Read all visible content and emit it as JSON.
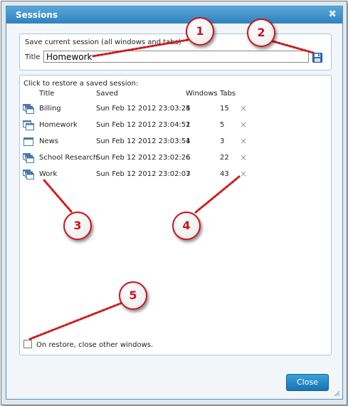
{
  "dialog": {
    "title": "Sessions"
  },
  "save_section": {
    "heading": "Save current session (all windows and tabs)",
    "title_label": "Title",
    "title_value": "Homework"
  },
  "restore_section": {
    "heading": "Click to restore a saved session:",
    "columns": {
      "title": "Title",
      "saved": "Saved",
      "windows": "Windows",
      "tabs": "Tabs"
    },
    "sessions": [
      {
        "title": "Billing",
        "saved": "Sun Feb 12 2012 23:03:25",
        "windows": "4",
        "tabs": "15",
        "icon": "multi-window-icon"
      },
      {
        "title": "Homework",
        "saved": "Sun Feb 12 2012 23:04:51",
        "windows": "2",
        "tabs": "5",
        "icon": "multi-window-icon"
      },
      {
        "title": "News",
        "saved": "Sun Feb 12 2012 23:03:54",
        "windows": "1",
        "tabs": "3",
        "icon": "single-window-icon"
      },
      {
        "title": "School Research",
        "saved": "Sun Feb 12 2012 23:02:26",
        "windows": "6",
        "tabs": "22",
        "icon": "multi-window-icon"
      },
      {
        "title": "Work",
        "saved": "Sun Feb 12 2012 23:02:03",
        "windows": "7",
        "tabs": "43",
        "icon": "multi-window-icon"
      }
    ],
    "delete_glyph": "×",
    "close_others_label": "On restore, close other windows."
  },
  "footer": {
    "close_label": "Close"
  },
  "callouts": [
    "1",
    "2",
    "3",
    "4",
    "5"
  ],
  "colors": {
    "titlebar": "#3b8fca",
    "callout_red": "#c8141a",
    "button_blue": "#1f7fc0"
  }
}
